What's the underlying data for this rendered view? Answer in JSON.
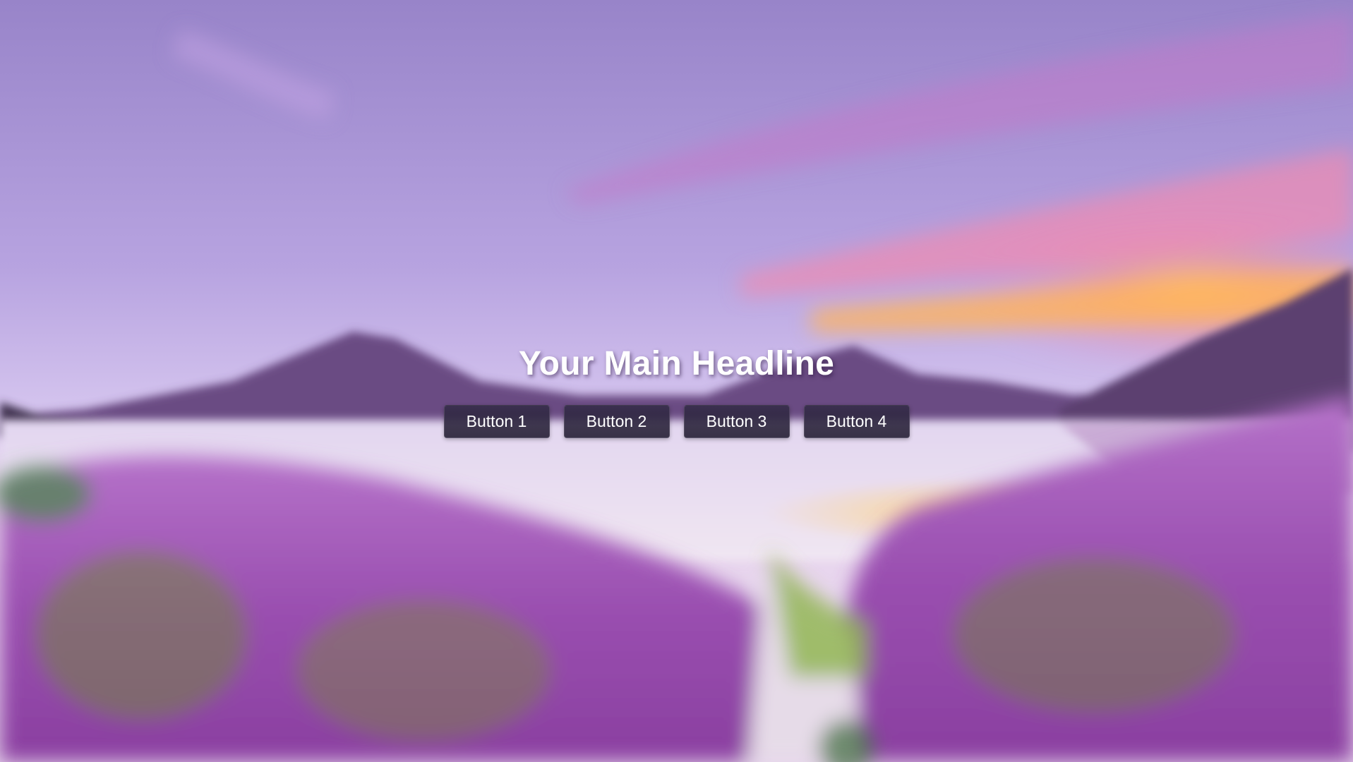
{
  "hero": {
    "headline": "Your Main Headline",
    "buttons": [
      {
        "label": "Button 1"
      },
      {
        "label": "Button 2"
      },
      {
        "label": "Button 3"
      },
      {
        "label": "Button 4"
      }
    ]
  },
  "colors": {
    "sky_top": "#9a86cc",
    "sky_mid": "#c7b6e8",
    "sunset_orange": "#f3b26a",
    "sunset_pink": "#e68ac2",
    "mountain": "#6c4c84",
    "lake": "#d8cde9",
    "lavender": "#a25ab8",
    "grass": "#6b8a3c",
    "button_bg": "#2c2440",
    "text": "#ffffff"
  }
}
